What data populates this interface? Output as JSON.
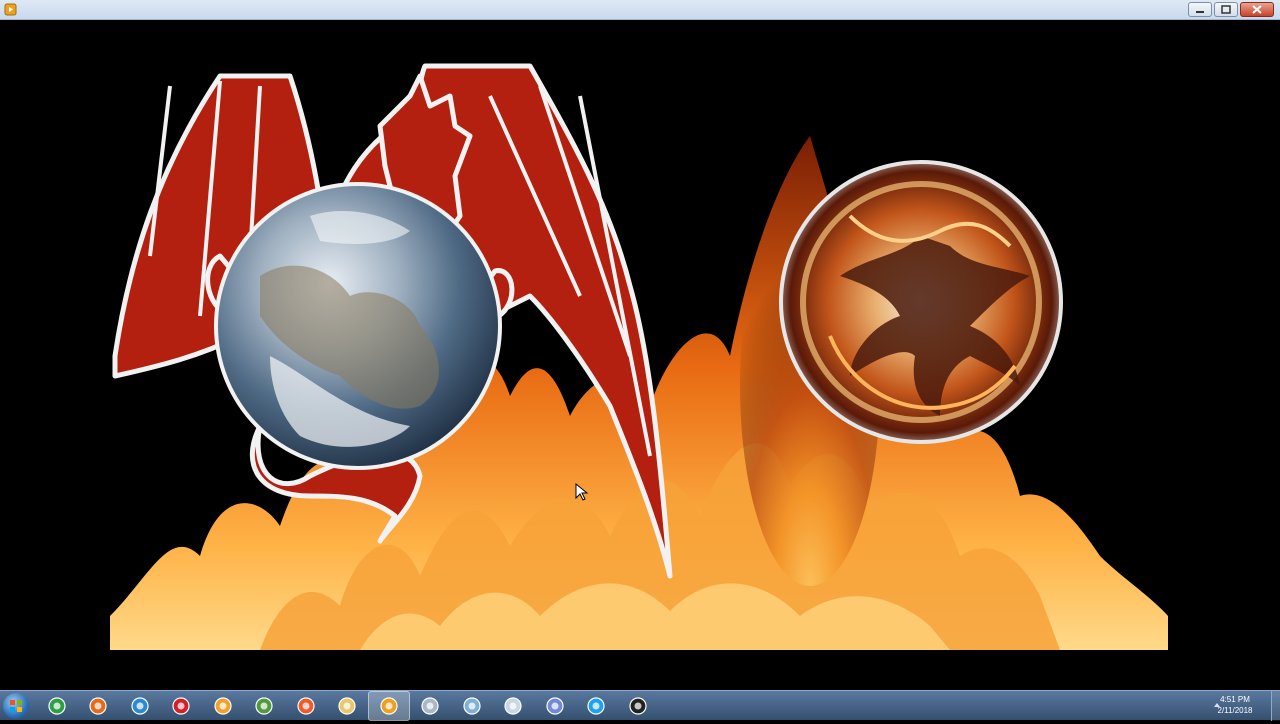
{
  "window": {
    "title": "",
    "controls": [
      "minimize-icon",
      "maximize-icon",
      "close-icon"
    ]
  },
  "slide": {
    "left_image": "red dragon holding planet Earth",
    "right_image": "phoenix emblem circle",
    "background": "flames"
  },
  "taskbar": {
    "start": "windows-start-icon",
    "pinned": [
      {
        "name": "chrome-icon",
        "color": "#2e9e47"
      },
      {
        "name": "firefox-icon",
        "color": "#e56a1c"
      },
      {
        "name": "internet-explorer-icon",
        "color": "#2b8ad6"
      },
      {
        "name": "opera-icon",
        "color": "#d51f26"
      },
      {
        "name": "chromium-icon",
        "color": "#f2a22b"
      },
      {
        "name": "globe-browser-icon",
        "color": "#4f9a3b"
      },
      {
        "name": "brave-icon",
        "color": "#f05a28"
      },
      {
        "name": "file-explorer-icon",
        "color": "#e9c86a"
      },
      {
        "name": "media-player-icon",
        "color": "#f0a020"
      },
      {
        "name": "calculator-icon",
        "color": "#a9b7c6"
      },
      {
        "name": "notepad-icon",
        "color": "#7fb0d6"
      },
      {
        "name": "paint-icon",
        "color": "#c8d6e6"
      },
      {
        "name": "discord-icon",
        "color": "#7289da"
      },
      {
        "name": "skype-icon",
        "color": "#1da1f2"
      },
      {
        "name": "obs-icon",
        "color": "#222222"
      }
    ],
    "active_index": 8,
    "clock": {
      "time": "4:51 PM",
      "date": "2/11/2018"
    }
  }
}
